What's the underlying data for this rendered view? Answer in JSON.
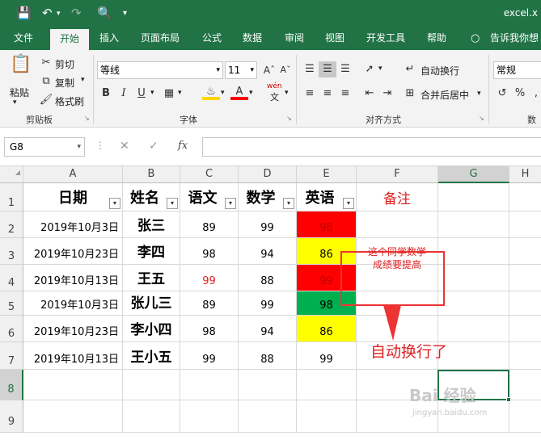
{
  "titlebar": {
    "title": "excel.x"
  },
  "tabs": [
    "文件",
    "开始",
    "插入",
    "页面布局",
    "公式",
    "数据",
    "审阅",
    "视图",
    "开发工具",
    "帮助",
    "告诉我你想"
  ],
  "ribbon": {
    "paste": "粘贴",
    "cut": "剪切",
    "copy": "复制",
    "format_painter": "格式刷",
    "clipboard_group": "剪贴板",
    "font_name": "等线",
    "font_size": "11",
    "bold": "B",
    "italic": "I",
    "underline": "U",
    "font_group": "字体",
    "wrap_text": "自动换行",
    "merge_center": "合并后居中",
    "align_group": "对齐方式",
    "number_format": "常规",
    "number_group": "数",
    "phonetic": "wén",
    "percent": "%"
  },
  "formula_bar": {
    "name_box": "G8",
    "fx": "fx"
  },
  "columns": [
    "A",
    "B",
    "C",
    "D",
    "E",
    "F",
    "G",
    "H"
  ],
  "rows": [
    "1",
    "2",
    "3",
    "4",
    "5",
    "6",
    "7",
    "8",
    "9"
  ],
  "headers": {
    "a": "日期",
    "b": "姓名",
    "c": "语文",
    "d": "数学",
    "e": "英语",
    "f": "备注"
  },
  "data_rows": [
    {
      "date": "2019年10月3日",
      "name": "张三",
      "chinese": "89",
      "math": "99",
      "english": "98"
    },
    {
      "date": "2019年10月23日",
      "name": "李四",
      "chinese": "98",
      "math": "94",
      "english": "86"
    },
    {
      "date": "2019年10月13日",
      "name": "王五",
      "chinese": "99",
      "math": "88",
      "english": "99"
    },
    {
      "date": "2019年10月3日",
      "name": "张儿三",
      "chinese": "89",
      "math": "99",
      "english": "98"
    },
    {
      "date": "2019年10月23日",
      "name": "李小四",
      "chinese": "98",
      "math": "94",
      "english": "86"
    },
    {
      "date": "2019年10月13日",
      "name": "王小五",
      "chinese": "99",
      "math": "88",
      "english": "99"
    }
  ],
  "note": "这个同学数学成绩要提高",
  "callout": "自动换行了",
  "watermark": {
    "main": "Bai 经验",
    "sub": "jingyan.baidu.com"
  },
  "colors": {
    "brand": "#217346",
    "red_fill": "#ff0000",
    "yellow_fill": "#ffff00",
    "green_fill": "#00b050",
    "red_text": "#e02020"
  }
}
